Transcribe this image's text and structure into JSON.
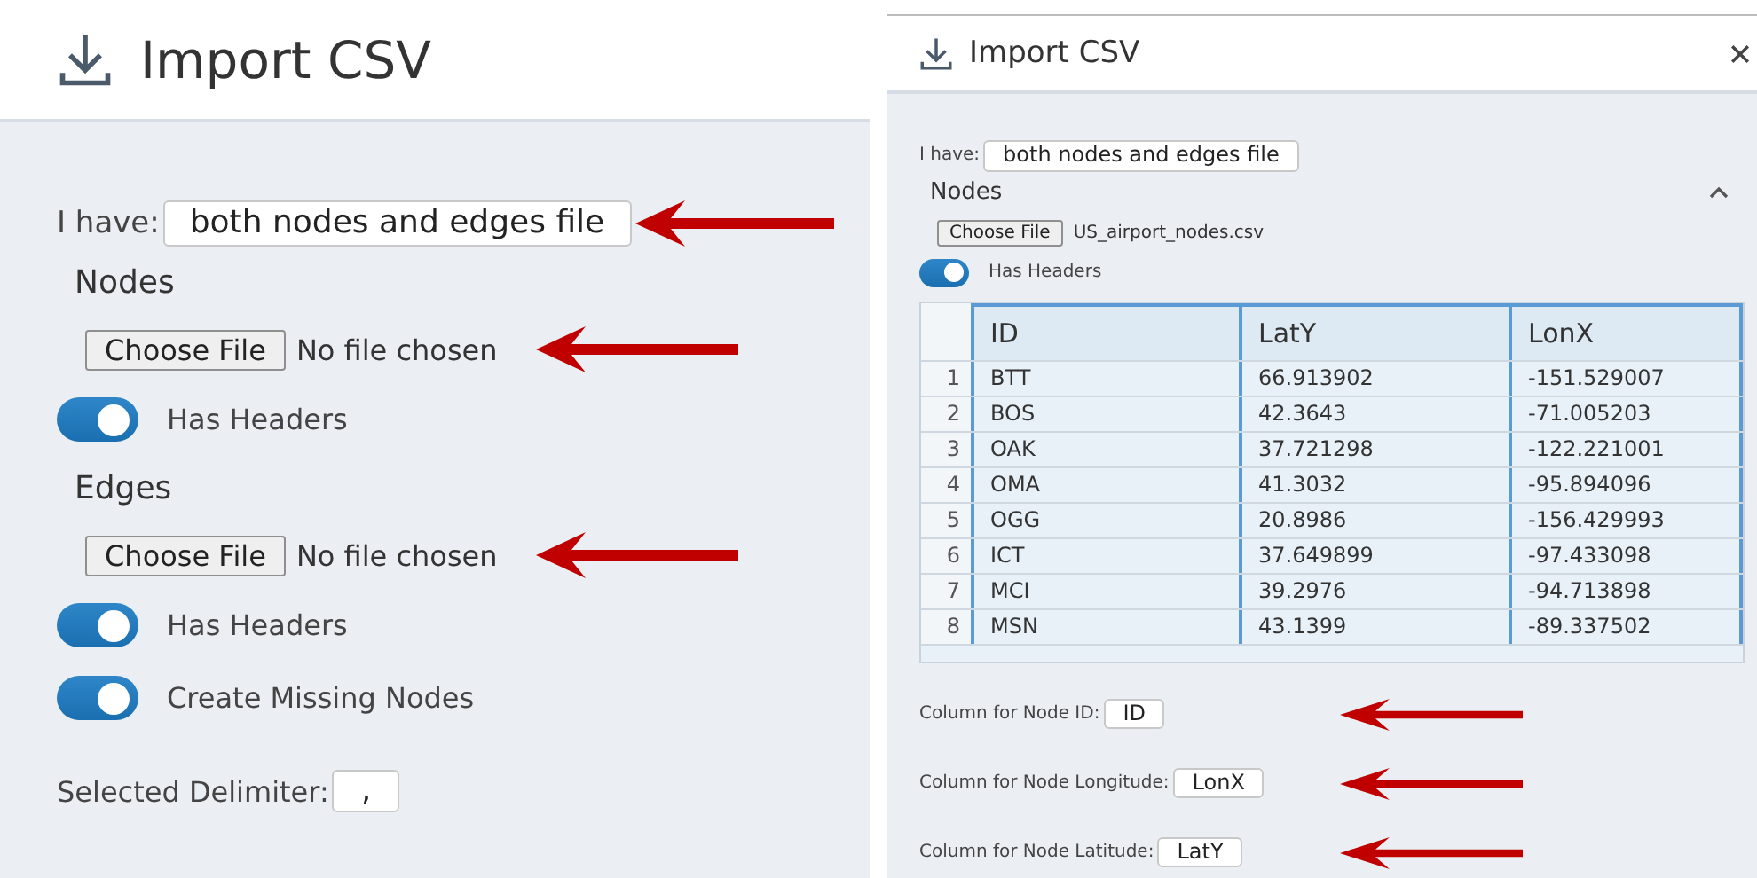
{
  "left": {
    "title": "Import CSV",
    "i_have": {
      "label": "I have:",
      "value": "both nodes and edges file"
    },
    "sections": [
      {
        "heading": "Nodes",
        "file": {
          "button": "Choose File",
          "status": "No file chosen"
        },
        "toggles": [
          {
            "label": "Has Headers",
            "on": true
          }
        ]
      },
      {
        "heading": "Edges",
        "file": {
          "button": "Choose File",
          "status": "No file chosen"
        },
        "toggles": [
          {
            "label": "Has Headers",
            "on": true
          },
          {
            "label": "Create Missing Nodes",
            "on": true
          }
        ]
      }
    ],
    "delimiter": {
      "label": "Selected Delimiter:",
      "value": ","
    }
  },
  "right": {
    "title": "Import CSV",
    "i_have": {
      "label": "I have:",
      "value": "both nodes and edges file"
    },
    "section": {
      "heading": "Nodes",
      "expanded": true,
      "file": {
        "button": "Choose File",
        "status": "US_airport_nodes.csv"
      },
      "toggles": [
        {
          "label": "Has Headers",
          "on": true
        }
      ]
    },
    "table": {
      "columns": [
        "ID",
        "LatY",
        "LonX"
      ],
      "rows": [
        {
          "number": "1",
          "cells": [
            "BTT",
            "66.913902",
            "-151.529007"
          ]
        },
        {
          "number": "2",
          "cells": [
            "BOS",
            "42.3643",
            "-71.005203"
          ]
        },
        {
          "number": "3",
          "cells": [
            "OAK",
            "37.721298",
            "-122.221001"
          ]
        },
        {
          "number": "4",
          "cells": [
            "OMA",
            "41.3032",
            "-95.894096"
          ]
        },
        {
          "number": "5",
          "cells": [
            "OGG",
            "20.8986",
            "-156.429993"
          ]
        },
        {
          "number": "6",
          "cells": [
            "ICT",
            "37.649899",
            "-97.433098"
          ]
        },
        {
          "number": "7",
          "cells": [
            "MCI",
            "39.2976",
            "-94.713898"
          ]
        },
        {
          "number": "8",
          "cells": [
            "MSN",
            "43.1399",
            "-89.337502"
          ]
        }
      ]
    },
    "mappings": [
      {
        "label": "Column for Node ID:",
        "value": "ID"
      },
      {
        "label": "Column for Node Longitude:",
        "value": "LonX"
      },
      {
        "label": "Column for Node Latitude:",
        "value": "LatY"
      }
    ]
  }
}
